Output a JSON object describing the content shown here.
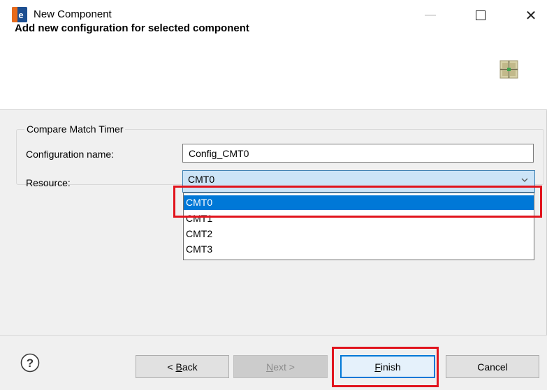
{
  "window": {
    "title": "New Component",
    "minimize_glyph": "—",
    "close_glyph": "✕"
  },
  "banner": {
    "title": "Add new configuration for selected component",
    "icon": "component-grid-icon"
  },
  "group": {
    "label": "Compare Match Timer"
  },
  "form": {
    "config_name_label": "Configuration name:",
    "config_name_value": "Config_CMT0",
    "resource_label": "Resource:",
    "resource_value": "CMT0"
  },
  "dropdown": {
    "options": [
      "CMT0",
      "CMT1",
      "CMT2",
      "CMT3"
    ],
    "selected_index": 0
  },
  "buttons": {
    "back_prefix": "< ",
    "back_mnemonic": "B",
    "back_rest": "ack",
    "next_mnemonic": "N",
    "next_rest": "ext >",
    "finish_mnemonic": "F",
    "finish_rest": "inish",
    "cancel": "Cancel"
  },
  "colors": {
    "selection": "#0078d7",
    "highlight": "#e1141d",
    "select_bg": "#cce4f7"
  }
}
